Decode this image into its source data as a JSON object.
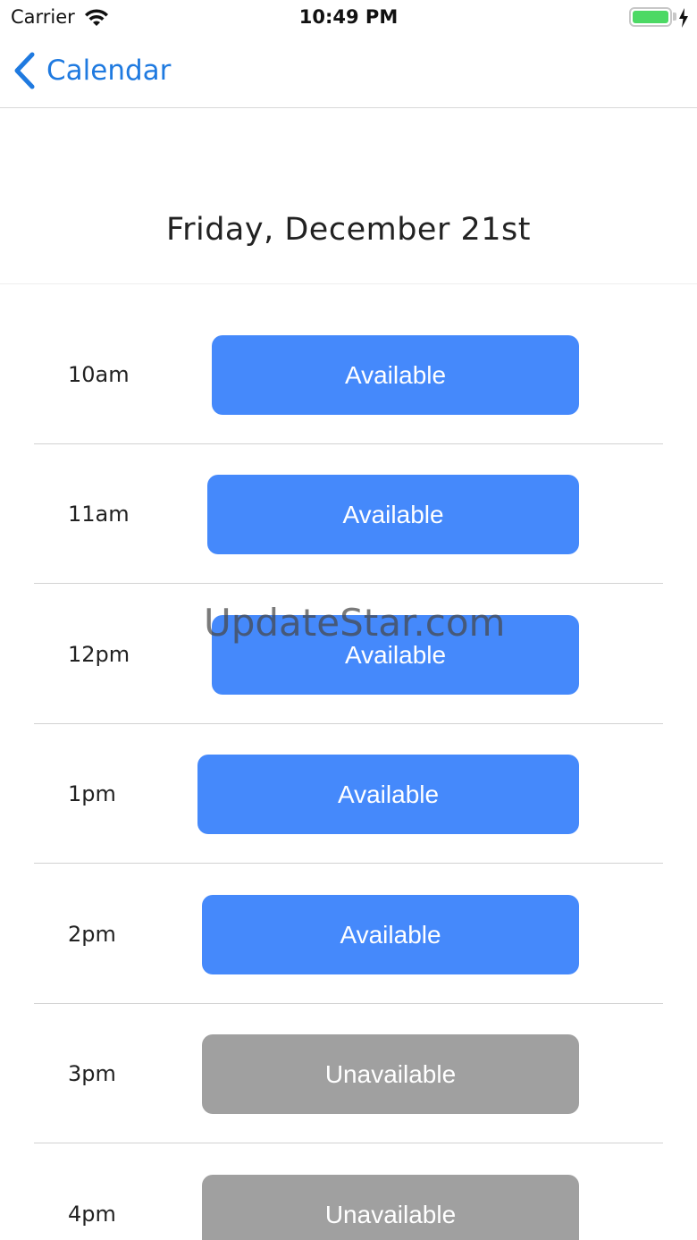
{
  "status_bar": {
    "carrier": "Carrier",
    "time": "10:49 PM",
    "icons": [
      "wifi-icon",
      "battery-icon",
      "charging-bolt-icon"
    ],
    "battery_color": "#4cd964"
  },
  "nav": {
    "back_label": "Calendar",
    "back_icon": "chevron-left-icon",
    "accent_color": "#1f7ae0"
  },
  "date_title": "Friday, December 21st",
  "slots": [
    {
      "time": "10am",
      "status": "Available"
    },
    {
      "time": "11am",
      "status": "Available"
    },
    {
      "time": "12pm",
      "status": "Available"
    },
    {
      "time": "1pm",
      "status": "Available"
    },
    {
      "time": "2pm",
      "status": "Available"
    },
    {
      "time": "3pm",
      "status": "Unavailable"
    },
    {
      "time": "4pm",
      "status": "Unavailable"
    }
  ],
  "colors": {
    "available": "#4589fb",
    "unavailable": "#a0a0a0"
  },
  "watermark": "UpdateStar.com"
}
